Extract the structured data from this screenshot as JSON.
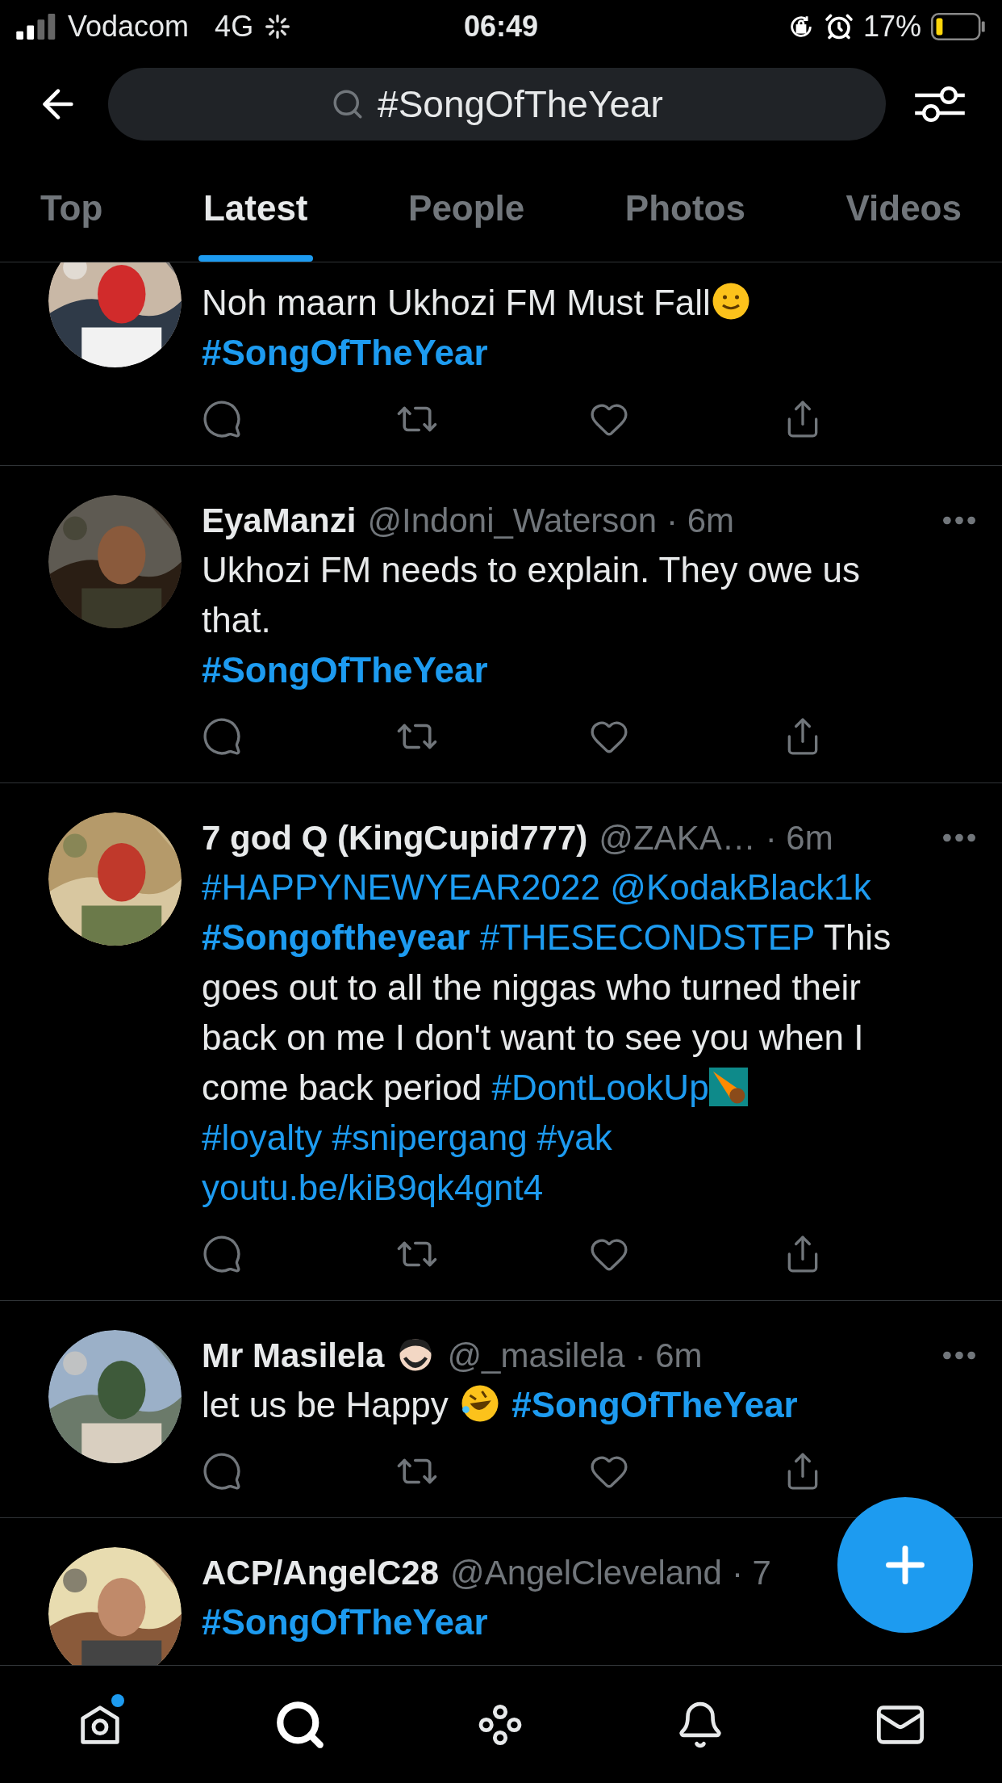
{
  "status_bar": {
    "carrier": "Vodacom",
    "network": "4G",
    "time": "06:49",
    "battery": "17%"
  },
  "search": {
    "value": "#SongOfTheYear"
  },
  "tabs": [
    {
      "label": "Top",
      "selected": false
    },
    {
      "label": "Latest",
      "selected": true
    },
    {
      "label": "People",
      "selected": false
    },
    {
      "label": "Photos",
      "selected": false
    },
    {
      "label": "Videos",
      "selected": false
    }
  ],
  "tweets": [
    {
      "menu": false,
      "actions": true,
      "segments": [
        {
          "kind": "text",
          "text": "Noh maarn Ukhozi FM Must Fall"
        },
        {
          "kind": "smile"
        },
        {
          "kind": "break"
        },
        {
          "kind": "tag",
          "text": "#SongOfTheYear"
        }
      ]
    },
    {
      "name": "EyaManzi",
      "name_emoji": false,
      "handle": "@Indoni_Waterson",
      "time": "· 6m",
      "menu": true,
      "actions": true,
      "segments": [
        {
          "kind": "text",
          "text": "Ukhozi FM needs to explain. They owe us that."
        },
        {
          "kind": "break"
        },
        {
          "kind": "tag",
          "text": "#SongOfTheYear"
        }
      ]
    },
    {
      "name": "7 god Q (KingCupid777)",
      "name_emoji": false,
      "handle": "@ZAKA…",
      "time": "· 6m",
      "menu": true,
      "actions": true,
      "segments": [
        {
          "kind": "link",
          "text": "#HAPPYNEWYEAR2022"
        },
        {
          "kind": "space"
        },
        {
          "kind": "link",
          "text": "@KodakBlack1k"
        },
        {
          "kind": "break"
        },
        {
          "kind": "tag",
          "text": "#Songoftheyear"
        },
        {
          "kind": "space"
        },
        {
          "kind": "space"
        },
        {
          "kind": "link",
          "text": "#THESECONDSTEP"
        },
        {
          "kind": "text",
          "text": " This goes out to all the niggas who turned their back on me I don't want to see you when I come back period "
        },
        {
          "kind": "link",
          "text": "#DontLookUp"
        },
        {
          "kind": "comet"
        },
        {
          "kind": "break"
        },
        {
          "kind": "link",
          "text": "#loyalty"
        },
        {
          "kind": "space"
        },
        {
          "kind": "link",
          "text": "#snipergang"
        },
        {
          "kind": "space"
        },
        {
          "kind": "link",
          "text": "#yak"
        },
        {
          "kind": "break"
        },
        {
          "kind": "link",
          "text": "youtu.be/kiB9qk4gnt4"
        }
      ]
    },
    {
      "name": "Mr Masilela",
      "name_emoji": true,
      "handle": "@_masilela",
      "time": "· 6m",
      "menu": true,
      "actions": true,
      "segments": [
        {
          "kind": "text",
          "text": "let us be Happy "
        },
        {
          "kind": "laugh"
        },
        {
          "kind": "space"
        },
        {
          "kind": "tag",
          "text": "#SongOfTheYear"
        }
      ]
    },
    {
      "name": "ACP/AngelC28",
      "name_emoji": false,
      "handle": "@AngelCleveland",
      "time": "· 7",
      "menu": false,
      "actions": false,
      "segments": [
        {
          "kind": "tag",
          "text": "#SongOfTheYear"
        }
      ]
    }
  ],
  "nav": [
    {
      "kind": "home",
      "selected": false,
      "badge": true
    },
    {
      "kind": "search",
      "selected": true,
      "badge": false
    },
    {
      "kind": "spaces",
      "selected": false,
      "badge": false
    },
    {
      "kind": "notifications",
      "selected": false,
      "badge": false
    },
    {
      "kind": "messages",
      "selected": false,
      "badge": false
    }
  ]
}
